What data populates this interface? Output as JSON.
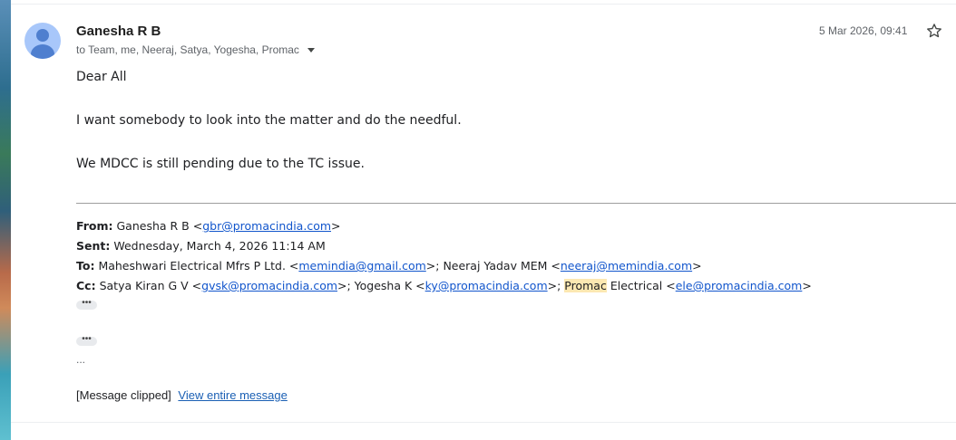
{
  "message": {
    "sender": "Ganesha R B",
    "recipients_prefix": "to",
    "recipients": "Team, me, Neeraj, Satya, Yogesha, Promac",
    "date": "5 Mar 2026, 09:41"
  },
  "body": {
    "greeting": "Dear All",
    "line1": "I want somebody to look into the matter and do the needful.",
    "line2": "We MDCC is still pending due to the TC issue."
  },
  "quoted": {
    "from_label": "From:",
    "from_name": "Ganesha R B <",
    "from_email": "gbr@promacindia.com",
    "from_close": ">",
    "sent_label": "Sent:",
    "sent_value": "Wednesday, March 4, 2026 11:14 AM",
    "to_label": "To:",
    "to_name1": "Maheshwari Electrical Mfrs P Ltd. <",
    "to_email1": "memindia@gmail.com",
    "to_name2": ">; Neeraj Yadav MEM <",
    "to_email2": "neeraj@memindia.com",
    "to_close": ">",
    "cc_label": "Cc:",
    "cc_name1": "Satya Kiran G V <",
    "cc_email1": "gvsk@promacindia.com",
    "cc_name2": ">; Yogesha K <",
    "cc_email2": "ky@promacindia.com",
    "cc_name3_pre": ">; ",
    "cc_name3_hl": "Promac",
    "cc_name3_post": " Electrical <",
    "cc_email3": "ele@promacindia.com",
    "cc_close": ">"
  },
  "trimmed_dots": "•••",
  "ellipsis": "...",
  "footer": {
    "clipped_text": "[Message clipped]",
    "view_link": "View entire message"
  }
}
